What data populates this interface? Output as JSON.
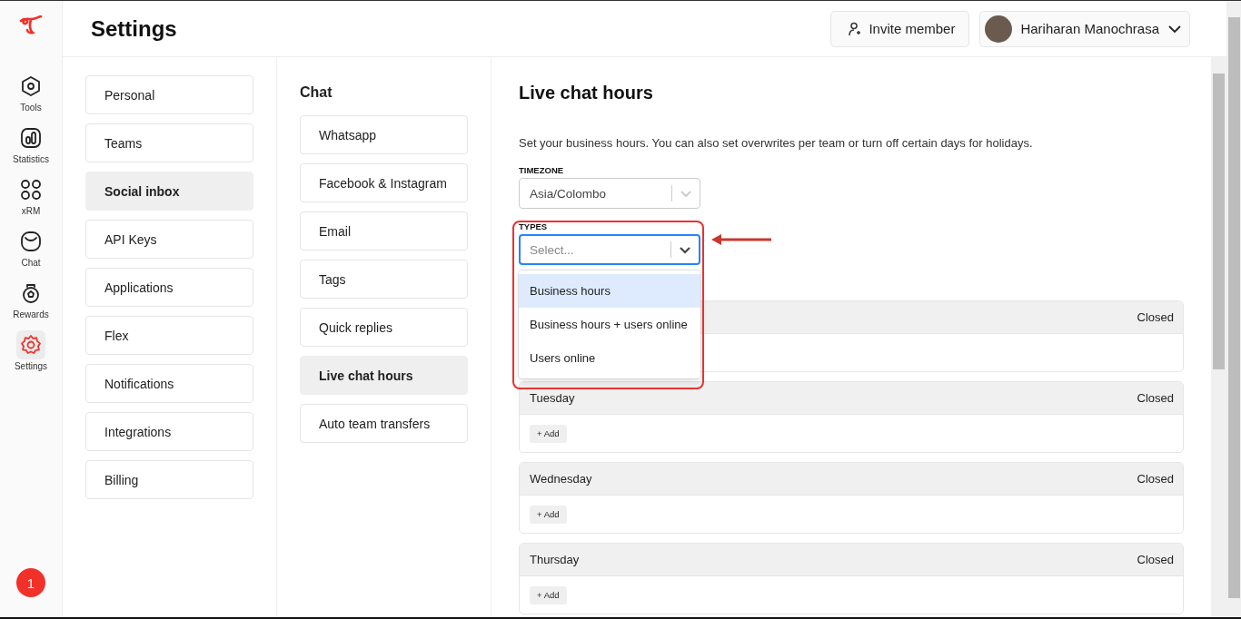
{
  "rail": {
    "items": [
      {
        "label": "Tools",
        "selected": false
      },
      {
        "label": "Statistics",
        "selected": false
      },
      {
        "label": "xRM",
        "selected": false
      },
      {
        "label": "Chat",
        "selected": false
      },
      {
        "label": "Rewards",
        "selected": false
      },
      {
        "label": "Settings",
        "selected": true
      }
    ],
    "badge": "1"
  },
  "header": {
    "title": "Settings",
    "invite_button": "Invite member",
    "user_name": "Hariharan Manochrasa"
  },
  "settings_menu": [
    {
      "label": "Personal",
      "selected": false
    },
    {
      "label": "Teams",
      "selected": false
    },
    {
      "label": "Social inbox",
      "selected": true
    },
    {
      "label": "API Keys",
      "selected": false
    },
    {
      "label": "Applications",
      "selected": false
    },
    {
      "label": "Flex",
      "selected": false
    },
    {
      "label": "Notifications",
      "selected": false
    },
    {
      "label": "Integrations",
      "selected": false
    },
    {
      "label": "Billing",
      "selected": false
    }
  ],
  "submenu": {
    "heading": "Chat",
    "items": [
      {
        "label": "Whatsapp",
        "selected": false
      },
      {
        "label": "Facebook & Instagram",
        "selected": false
      },
      {
        "label": "Email",
        "selected": false
      },
      {
        "label": "Tags",
        "selected": false
      },
      {
        "label": "Quick replies",
        "selected": false
      },
      {
        "label": "Live chat hours",
        "selected": true
      },
      {
        "label": "Auto team transfers",
        "selected": false
      }
    ]
  },
  "content": {
    "title": "Live chat hours",
    "description": "Set your business hours. You can also set overwrites per team or turn off certain days for holidays.",
    "timezone": {
      "label": "TIMEZONE",
      "value": "Asia/Colombo"
    },
    "types": {
      "label": "TYPES",
      "placeholder": "Select...",
      "expanded": true,
      "options": [
        {
          "label": "Business hours",
          "selected": true
        },
        {
          "label": "Business hours + users online",
          "selected": false
        },
        {
          "label": "Users online",
          "selected": false
        }
      ]
    },
    "days": [
      {
        "status": "Closed"
      },
      {
        "day": "Tuesday",
        "status": "Closed",
        "add": "+ Add"
      },
      {
        "day": "Wednesday",
        "status": "Closed",
        "add": "+ Add"
      },
      {
        "day": "Thursday",
        "status": "Closed",
        "add": "+ Add"
      }
    ]
  }
}
